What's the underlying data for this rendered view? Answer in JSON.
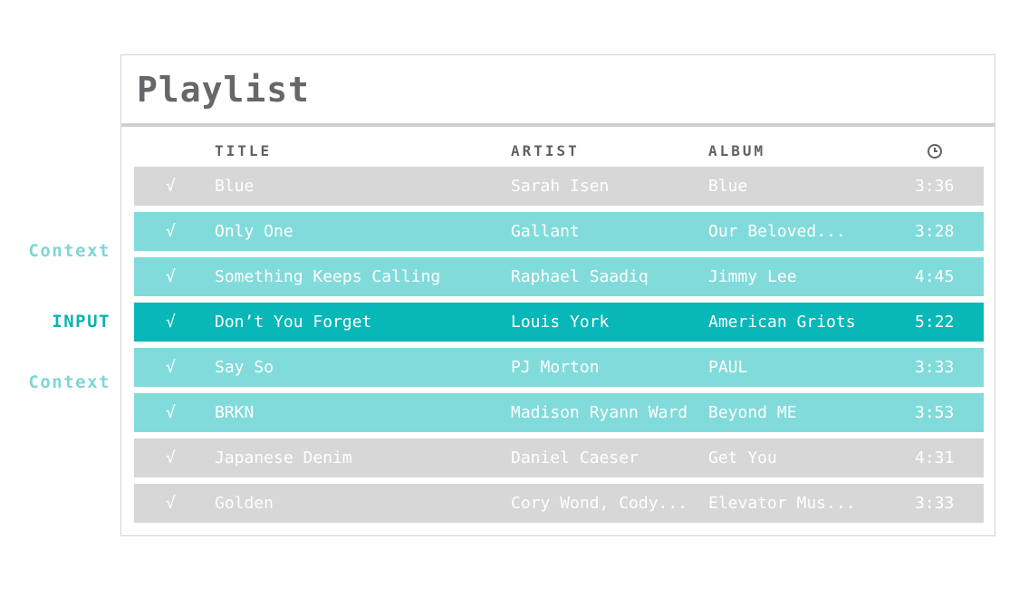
{
  "colors": {
    "context": "#82dbdb",
    "input": "#08b7b7",
    "neutral": "#d7d7d7",
    "context_label": "#7fd6d6",
    "input_label": "#0eb2b2"
  },
  "side_labels": [
    {
      "text": "Context",
      "kind": "context"
    },
    {
      "text": "INPUT",
      "kind": "input"
    },
    {
      "text": "Context",
      "kind": "context"
    }
  ],
  "playlist": {
    "title": "Playlist",
    "columns": {
      "title": "TITLE",
      "artist": "ARTIST",
      "album": "ALBUM",
      "duration_icon": "clock-icon"
    },
    "rows": [
      {
        "check": "√",
        "title": "Blue",
        "artist": "Sarah Isen",
        "album": "Blue",
        "time": "3:36",
        "kind": "neutral"
      },
      {
        "check": "√",
        "title": "Only One",
        "artist": "Gallant",
        "album": "Our Beloved...",
        "time": "3:28",
        "kind": "context"
      },
      {
        "check": "√",
        "title": "Something Keeps Calling",
        "artist": "Raphael Saadiq",
        "album": "Jimmy Lee",
        "time": "4:45",
        "kind": "context"
      },
      {
        "check": "√",
        "title": "Don’t You Forget",
        "artist": "Louis York",
        "album": "American Griots",
        "time": "5:22",
        "kind": "input"
      },
      {
        "check": "√",
        "title": "Say So",
        "artist": "PJ Morton",
        "album": "PAUL",
        "time": "3:33",
        "kind": "context"
      },
      {
        "check": "√",
        "title": "BRKN",
        "artist": "Madison Ryann Ward",
        "album": "Beyond ME",
        "time": "3:53",
        "kind": "context"
      },
      {
        "check": "√",
        "title": "Japanese Denim",
        "artist": "Daniel Caeser",
        "album": "Get You",
        "time": "4:31",
        "kind": "neutral"
      },
      {
        "check": "√",
        "title": "Golden",
        "artist": "Cory Wond, Cody...",
        "album": "Elevator Mus...",
        "time": "3:33",
        "kind": "neutral"
      }
    ]
  }
}
